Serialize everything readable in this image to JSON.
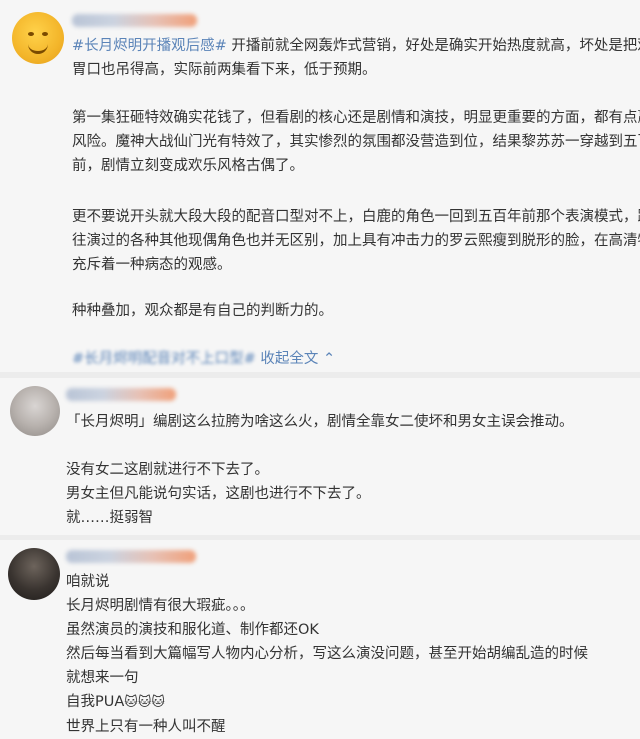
{
  "post": {
    "hashtag": "#长月烬明开播观后感#",
    "lines": [
      "开播前就全网轰炸式营销，好处是确实开始热度就高，坏处是把观众",
      "胃口也吊得高，实际前两集看下来，低于预期。",
      "",
      "第一集狂砸特效确实花钱了，但看剧的核心还是剧情和演技，明显更重要的方面，都有点赢弱",
      "风险。魔神大战仙门光有特效了，其实惨烈的氛围都没营造到位，结果黎苏苏一穿越到五百年",
      "前，剧情立刻变成欢乐风格古偶了。",
      "",
      "更不要说开头就大段大段的配音口型对不上，白鹿的角色一回到五百年前那个表演模式，跟她",
      "往演过的各种其他现偶角色也并无区别，加上具有冲击力的罗云熙瘦到脱形的脸，在高清特写",
      "充斥着一种病态的观感。",
      "",
      "种种叠加，观众都是有自己的判断力的。"
    ],
    "footer_tag": "#长月烬明配音对不上口型#",
    "collapse_label": "收起全文 ⌃"
  },
  "comment1": {
    "lines": [
      "「长月烬明」编剧这么拉胯为啥这么火，剧情全靠女二使坏和男女主误会推动。",
      "",
      "没有女二这剧就进行不下去了。",
      "男女主但凡能说句实话，这剧也进行不下去了。",
      "就……挺弱智"
    ]
  },
  "comment2": {
    "lines": [
      "咱就说",
      "长月烬明剧情有很大瑕疵。。。",
      "虽然演员的演技和服化道、制作都还OK",
      "然后每当看到大篇幅写人物内心分析，写这么演没问题，甚至开始胡编乱造的时候",
      "就想来一句",
      "自我PUA",
      "世界上只有一种人叫不醒"
    ],
    "emoji": "🐱🐱🐱"
  }
}
